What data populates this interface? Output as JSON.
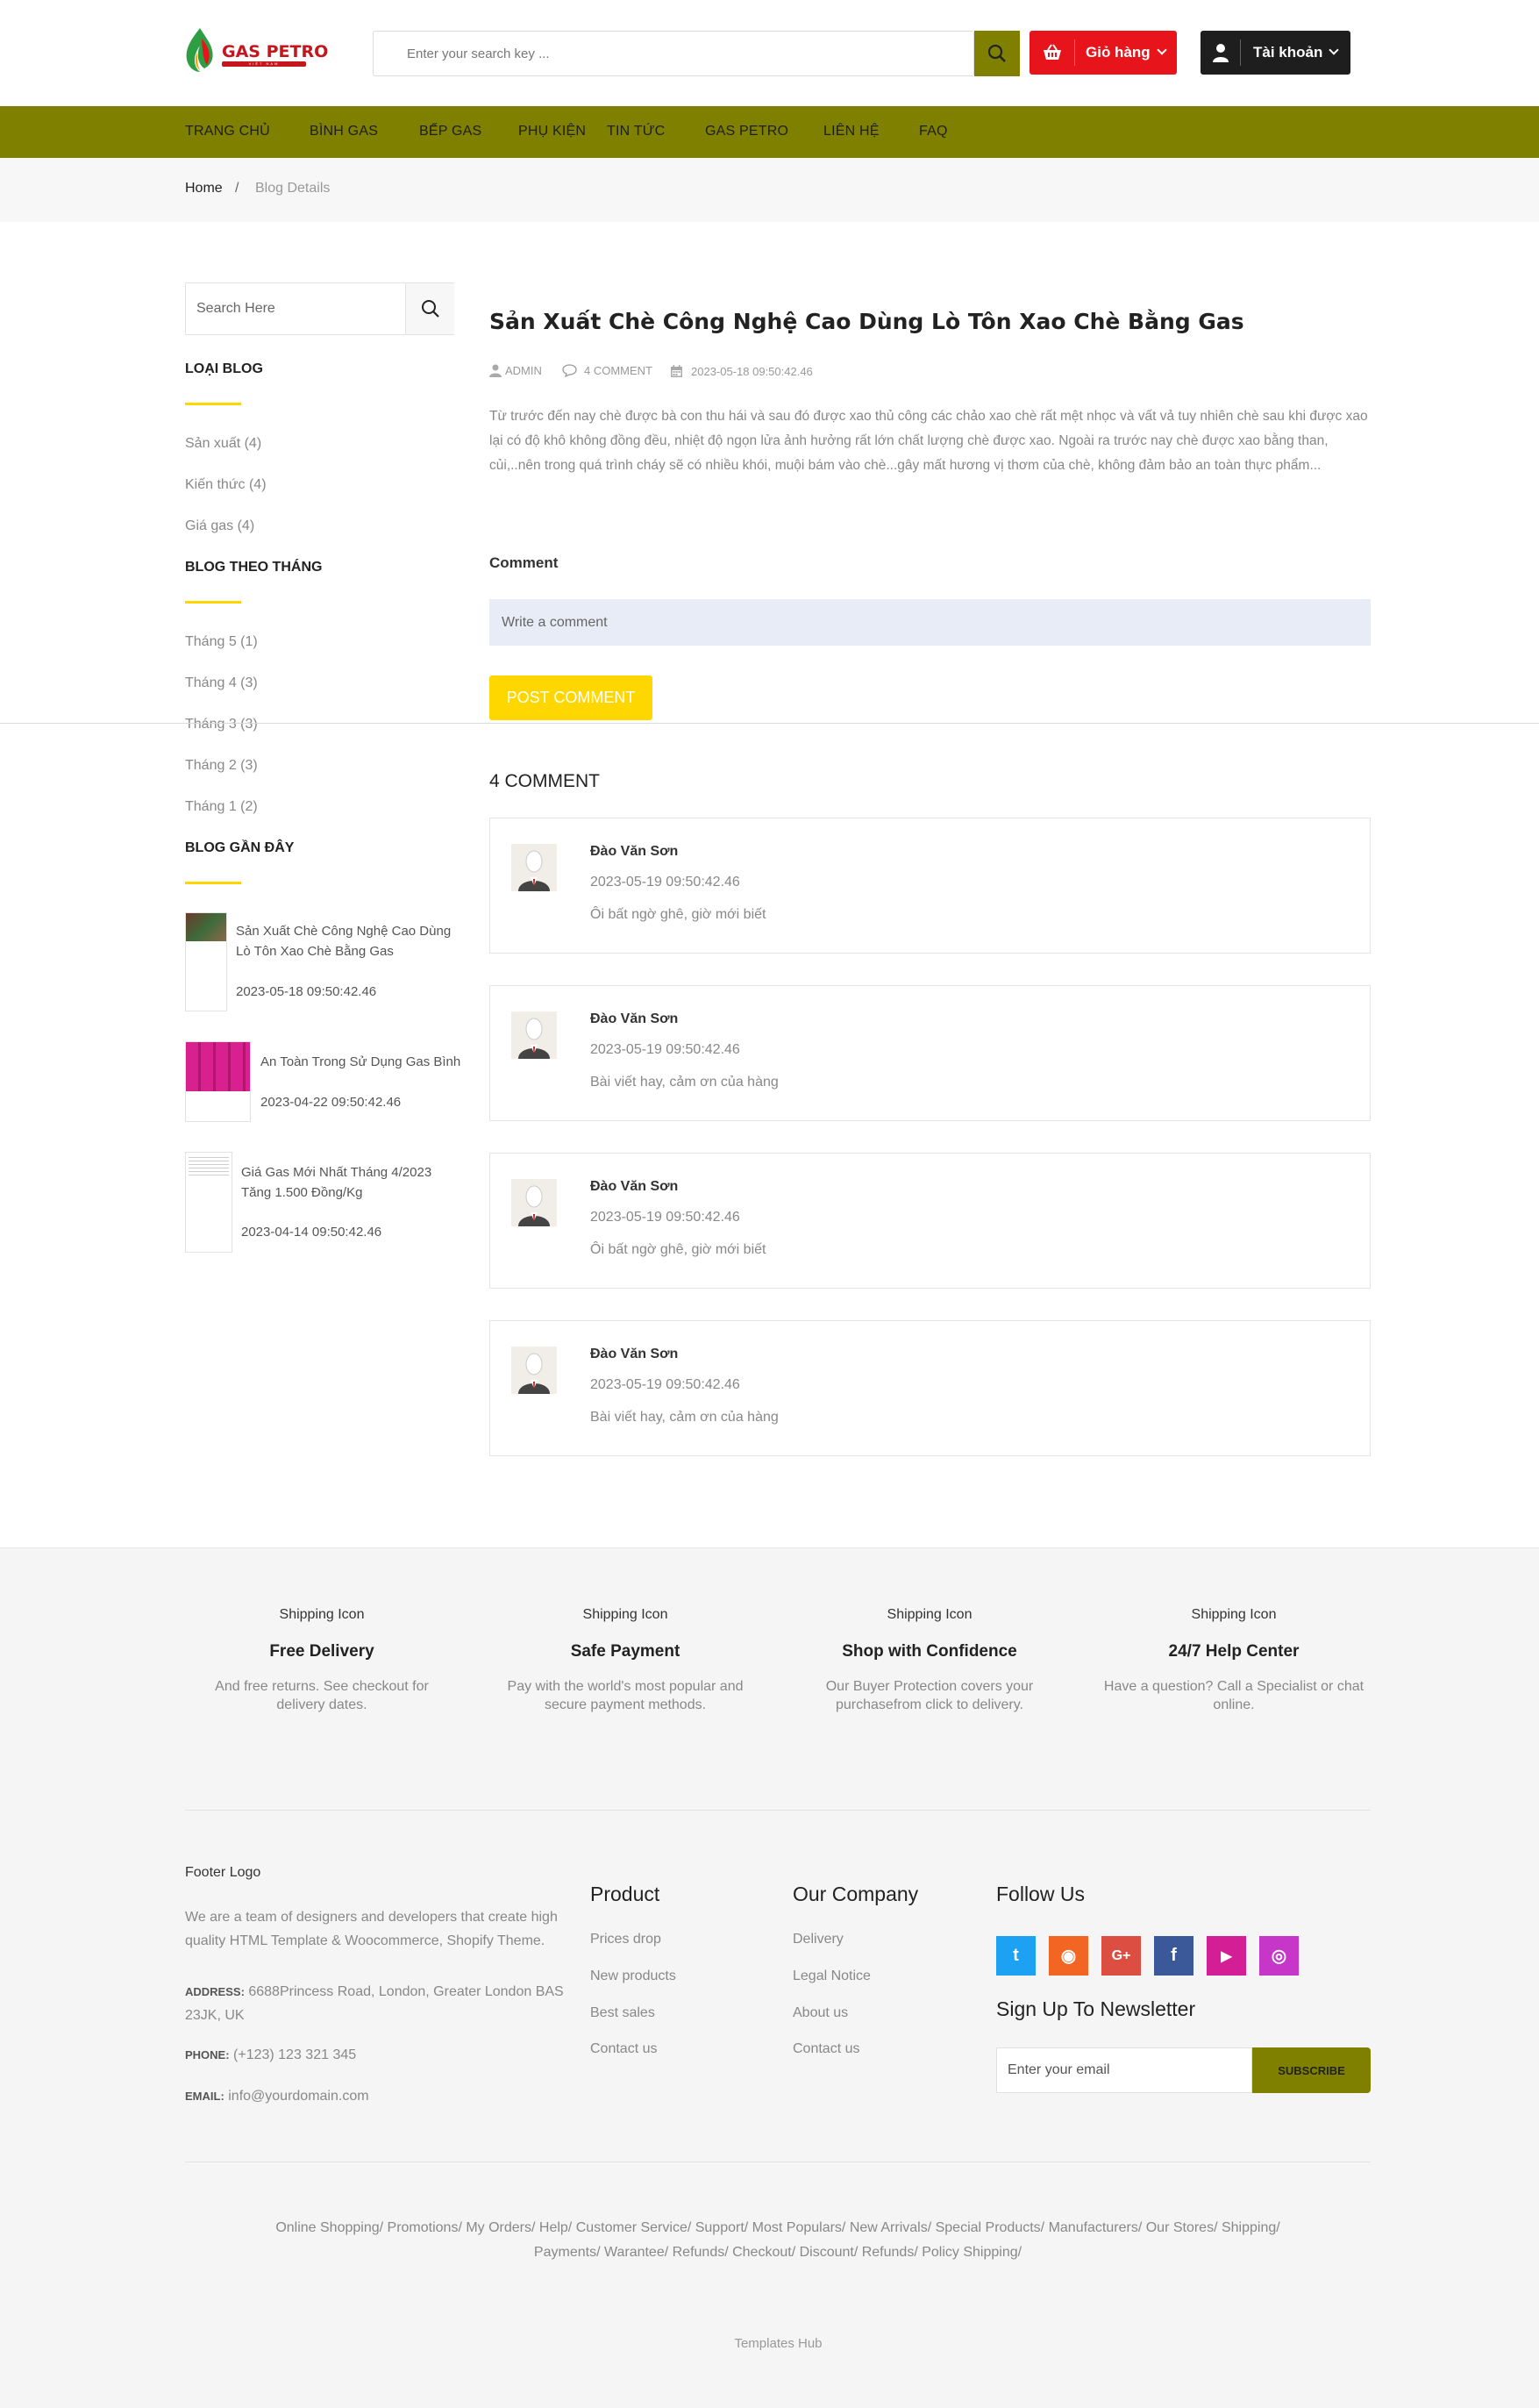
{
  "brand": {
    "name": "GAS PETRO",
    "tagline": "VIỆT NAM",
    "color_red": "#c4161c",
    "accent_olive": "#808000",
    "accent_yellow": "#ffd700"
  },
  "header": {
    "search_placeholder": "Enter your search key ...",
    "cart_label": "Giỏ hàng",
    "account_label": "Tài khoản"
  },
  "nav": [
    "TRANG CHỦ",
    "BÌNH GAS",
    "BẾP GAS",
    "PHỤ KIỆN",
    "TIN TỨC",
    "GAS PETRO",
    "LIÊN HỆ",
    "FAQ"
  ],
  "breadcrumb": {
    "home": "Home",
    "separator": "/",
    "current": "Blog Details"
  },
  "sidebar": {
    "search_placeholder": "Search Here",
    "categories_title": "LOẠI BLOG",
    "categories": [
      "Sản xuất (4)",
      "Kiến thức (4)",
      "Giá gas (4)"
    ],
    "months_title": "BLOG THEO THÁNG",
    "months": [
      "Tháng 5 (1)",
      "Tháng 4 (3)",
      "Tháng 3 (3)",
      "Tháng 2 (3)",
      "Tháng 1 (2)"
    ],
    "recent_title": "BLOG GẦN ĐÂY",
    "recent": [
      {
        "title": "Sản Xuất Chè Công Nghệ Cao Dùng Lò Tôn Xao Chè Bằng Gas",
        "date": "2023-05-18 09:50:42.46"
      },
      {
        "title": "An Toàn Trong Sử Dụng Gas Bình",
        "date": "2023-04-22 09:50:42.46"
      },
      {
        "title": "Giá Gas Mới Nhất Tháng 4/2023 Tăng 1.500 Đồng/Kg",
        "date": "2023-04-14 09:50:42.46"
      }
    ]
  },
  "post": {
    "title": "Sản Xuất Chè Công Nghệ Cao Dùng Lò Tôn Xao Chè Bằng Gas",
    "author": "ADMIN",
    "comment_count": "4 COMMENT",
    "date": "2023-05-18 09:50:42.46",
    "excerpt": "Từ trước đến nay chè được bà con thu hái và sau đó được xao thủ công các chảo xao chè rất mệt nhọc và vất vả tuy nhiên chè sau khi được xao lại có độ khô không đồng đều, nhiệt độ ngọn lửa ảnh hưởng rất lớn chất lượng chè được xao. Ngoài ra trước nay chè được xao bằng than, củi,..nên trong quá trình cháy sẽ có nhiều khói, muội bám vào chè...gây mất hương vị thơm của chè, không đảm bảo an toàn thực phẩm..."
  },
  "comment_form": {
    "label": "Comment",
    "placeholder": "Write a comment",
    "submit": "POST COMMENT"
  },
  "comments": {
    "heading": "4 COMMENT",
    "items": [
      {
        "name": "Đào Văn Sơn",
        "date": "2023-05-19 09:50:42.46",
        "text": "Ôi bất ngờ ghê, giờ mới biết"
      },
      {
        "name": "Đào Văn Sơn",
        "date": "2023-05-19 09:50:42.46",
        "text": "Bài viết hay, cảm ơn của hàng"
      },
      {
        "name": "Đào Văn Sơn",
        "date": "2023-05-19 09:50:42.46",
        "text": "Ôi bất ngờ ghê, giờ mới biết"
      },
      {
        "name": "Đào Văn Sơn",
        "date": "2023-05-19 09:50:42.46",
        "text": "Bài viết hay, cảm ơn của hàng"
      }
    ]
  },
  "features": [
    {
      "img_alt": "Shipping Icon",
      "title": "Free Delivery",
      "desc": "And free returns. See checkout for delivery dates."
    },
    {
      "img_alt": "Shipping Icon",
      "title": "Safe Payment",
      "desc": "Pay with the world's most popular and secure payment methods."
    },
    {
      "img_alt": "Shipping Icon",
      "title": "Shop with Confidence",
      "desc": "Our Buyer Protection covers your purchasefrom click to delivery."
    },
    {
      "img_alt": "Shipping Icon",
      "title": "24/7 Help Center",
      "desc": "Have a question? Call a Specialist or chat online."
    }
  ],
  "footer": {
    "logo_alt": "Footer Logo",
    "about": "We are a team of designers and developers that create high quality HTML Template & Woocommerce, Shopify Theme.",
    "address_label": "ADDRESS:",
    "address": "6688Princess Road, London, Greater London BAS 23JK, UK",
    "phone_label": "PHONE:",
    "phone": "(+123) 123 321 345",
    "email_label": "EMAIL:",
    "email": "info@yourdomain.com",
    "product_title": "Product",
    "product_links": [
      "Prices drop",
      "New products",
      "Best sales",
      "Contact us"
    ],
    "company_title": "Our Company",
    "company_links": [
      "Delivery",
      "Legal Notice",
      "About us",
      "Contact us"
    ],
    "follow_title": "Follow Us",
    "social": [
      {
        "name": "twitter-icon",
        "glyph": "t",
        "color": "#1da1f2"
      },
      {
        "name": "rss-icon",
        "glyph": "◉",
        "color": "#f26522"
      },
      {
        "name": "google-plus-icon",
        "glyph": "G+",
        "color": "#dc4e41"
      },
      {
        "name": "facebook-icon",
        "glyph": "f",
        "color": "#3b5998"
      },
      {
        "name": "youtube-icon",
        "glyph": "▶",
        "color": "#d41e95"
      },
      {
        "name": "instagram-icon",
        "glyph": "◎",
        "color": "#c536c9"
      }
    ],
    "newsletter_title": "Sign Up To Newsletter",
    "newsletter_placeholder": "Enter your email",
    "newsletter_button": "SUBSCRIBE",
    "links_line1": "Online Shopping/ Promotions/ My Orders/ Help/ Customer Service/ Support/ Most Populars/ New Arrivals/ Special Products/ Manufacturers/ Our Stores/ Shipping/",
    "links_line2": "Payments/ Warantee/ Refunds/ Checkout/ Discount/ Refunds/ Policy Shipping/",
    "copyright": "Templates Hub"
  }
}
